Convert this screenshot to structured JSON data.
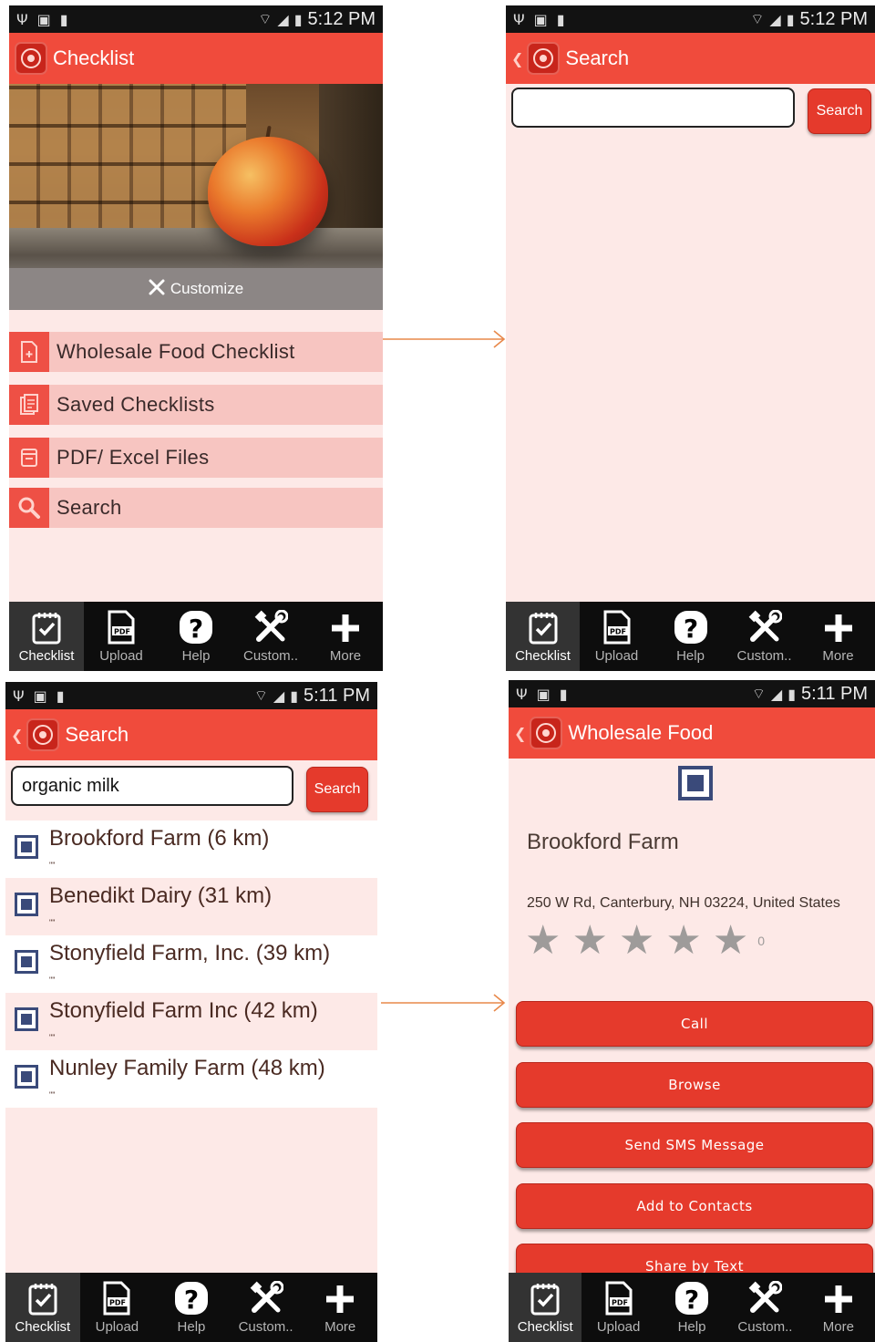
{
  "status_time_top": "5:12 PM",
  "status_time_bottom": "5:11 PM",
  "tabs": [
    {
      "label": "Checklist",
      "icon": "checklist-icon"
    },
    {
      "label": "Upload",
      "icon": "pdf-upload-icon"
    },
    {
      "label": "Help",
      "icon": "help-icon"
    },
    {
      "label": "Custom..",
      "icon": "tools-icon"
    },
    {
      "label": "More",
      "icon": "plus-icon"
    }
  ],
  "screen_checklist": {
    "title": "Checklist",
    "customize_label": "Customize",
    "menu": [
      {
        "label": "Wholesale Food Checklist",
        "icon": "new-doc-icon"
      },
      {
        "label": "Saved Checklists",
        "icon": "saved-docs-icon"
      },
      {
        "label": "PDF/ Excel Files",
        "icon": "files-icon"
      },
      {
        "label": "Search",
        "icon": "search-icon"
      }
    ]
  },
  "screen_search_empty": {
    "title": "Search",
    "query": "",
    "button": "Search"
  },
  "screen_search_results": {
    "title": "Search",
    "query": "organic milk",
    "button": "Search",
    "results": [
      {
        "name": "Brookford Farm (6 km)",
        "sub": "\"\""
      },
      {
        "name": "Benedikt Dairy (31 km)",
        "sub": "\"\""
      },
      {
        "name": "Stonyfield Farm, Inc. (39 km)",
        "sub": "\"\""
      },
      {
        "name": "Stonyfield Farm Inc (42 km)",
        "sub": "\"\""
      },
      {
        "name": "Nunley Family Farm (48 km)",
        "sub": "\"\""
      }
    ]
  },
  "screen_detail": {
    "title": "Wholesale Food",
    "name": "Brookford Farm",
    "address": "250 W Rd, Canterbury, NH 03224, United States",
    "rating_count": "0",
    "rating": 0,
    "buttons": [
      "Call",
      "Browse",
      "Send SMS Message",
      "Add to Contacts",
      "Share by Text"
    ]
  },
  "colors": {
    "accent": "#f04b3c",
    "button": "#e53a2c",
    "background": "#fde9e7",
    "menu_row": "#f7c5c1",
    "arrow": "#e8884a"
  }
}
